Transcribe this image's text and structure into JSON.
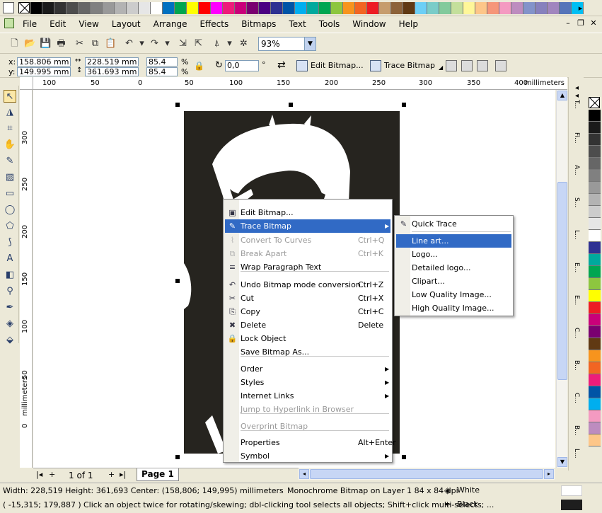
{
  "colors": {
    "chrome": "#ece9d8",
    "menu_highlight": "#316ac5",
    "bitmap_dark": "#26241f",
    "disabled_text": "#9a9a9a"
  },
  "palette_top": [
    "#000000",
    "#1a1a1a",
    "#333333",
    "#4d4d4d",
    "#666666",
    "#808080",
    "#999999",
    "#b3b3b3",
    "#cccccc",
    "#e6e6e6",
    "#ffffff",
    "#0070c0",
    "#00a550",
    "#ffff00",
    "#ff0000",
    "#ff00ff",
    "#ed1c7a",
    "#c9007a",
    "#7a0070",
    "#4b0082",
    "#2e3192",
    "#0054a6",
    "#00aeef",
    "#00a99d",
    "#00a651",
    "#8dc63f",
    "#f7941d",
    "#f26522",
    "#ed1c24",
    "#c69c6d",
    "#8c6239",
    "#603913",
    "#6dcff6",
    "#7accc8",
    "#82ca9c",
    "#c4df9b",
    "#fff799",
    "#fdc689",
    "#f69679",
    "#f49ac1",
    "#bd8cbf",
    "#8393ca",
    "#8781bd",
    "#a186be",
    "#5574b9",
    "#00bff3"
  ],
  "palette_right": [
    "#000000",
    "#1a1a1a",
    "#333333",
    "#4d4d4d",
    "#666666",
    "#808080",
    "#999999",
    "#b3b3b3",
    "#cccccc",
    "#e6e6e6",
    "#ffffff",
    "#2e3192",
    "#00a99d",
    "#00a651",
    "#8dc63f",
    "#ffff00",
    "#ed1c24",
    "#c9007a",
    "#7a0070",
    "#603913",
    "#f7941d",
    "#f26522",
    "#ed1c7a",
    "#0054a6",
    "#00aeef",
    "#f49ac1",
    "#bd8cbf",
    "#fdc689"
  ],
  "menubar": {
    "items": [
      "File",
      "Edit",
      "View",
      "Layout",
      "Arrange",
      "Effects",
      "Bitmaps",
      "Text",
      "Tools",
      "Window",
      "Help"
    ]
  },
  "standard_bar": {
    "zoom": "93%"
  },
  "property_bar": {
    "x_label": "x:",
    "y_label": "y:",
    "x": "158.806 mm",
    "y": "149.995 mm",
    "width": "228.519 mm",
    "height": "361.693 mm",
    "scale_w": "85.4",
    "scale_h": "85.4",
    "pct": "%",
    "angle": "0,0",
    "deg": "°",
    "edit_bitmap": "Edit Bitmap...",
    "trace_bitmap": "Trace Bitmap"
  },
  "hruler": {
    "ticks": [
      "100",
      "50",
      "0",
      "50",
      "100",
      "150",
      "200",
      "250",
      "300",
      "350",
      "400"
    ],
    "unit": "millimeters"
  },
  "vruler": {
    "ticks": [
      "300",
      "250",
      "200",
      "150",
      "100",
      "50",
      "0"
    ],
    "unit": "millimeters"
  },
  "dockers": [
    "T...",
    "Fi...",
    "A...",
    "S...",
    "L...",
    "E...",
    "E...",
    "C...",
    "B...",
    "C...",
    "B...",
    "L..."
  ],
  "context_menu": {
    "items": [
      {
        "label": "Edit Bitmap...",
        "shortcut": "",
        "icon": "edit-bitmap-icon",
        "state": "normal"
      },
      {
        "label": "Trace Bitmap",
        "shortcut": "",
        "icon": "trace-icon",
        "state": "highlight",
        "submenu": true
      },
      {
        "label": "Convert To Curves",
        "shortcut": "Ctrl+Q",
        "icon": "curves-icon",
        "state": "disabled"
      },
      {
        "label": "Break Apart",
        "shortcut": "Ctrl+K",
        "icon": "break-apart-icon",
        "state": "disabled"
      },
      {
        "label": "Wrap Paragraph Text",
        "shortcut": "",
        "icon": "wrap-text-icon",
        "state": "normal"
      },
      {
        "label": "Undo Bitmap mode conversion",
        "shortcut": "Ctrl+Z",
        "icon": "undo-icon",
        "state": "normal"
      },
      {
        "label": "Cut",
        "shortcut": "Ctrl+X",
        "icon": "scissors-icon",
        "state": "normal"
      },
      {
        "label": "Copy",
        "shortcut": "Ctrl+C",
        "icon": "copy-icon",
        "state": "normal"
      },
      {
        "label": "Delete",
        "shortcut": "Delete",
        "icon": "delete-icon",
        "state": "normal"
      },
      {
        "label": "Lock Object",
        "shortcut": "",
        "icon": "lock-icon",
        "state": "normal"
      },
      {
        "label": "Save Bitmap As...",
        "shortcut": "",
        "icon": "",
        "state": "normal"
      },
      {
        "label": "Order",
        "shortcut": "",
        "icon": "",
        "state": "normal",
        "submenu": true
      },
      {
        "label": "Styles",
        "shortcut": "",
        "icon": "",
        "state": "normal",
        "submenu": true
      },
      {
        "label": "Internet Links",
        "shortcut": "",
        "icon": "",
        "state": "normal",
        "submenu": true
      },
      {
        "label": "Jump to Hyperlink in Browser",
        "shortcut": "",
        "icon": "",
        "state": "disabled"
      },
      {
        "label": "Overprint Bitmap",
        "shortcut": "",
        "icon": "",
        "state": "disabled"
      },
      {
        "label": "Properties",
        "shortcut": "Alt+Enter",
        "icon": "",
        "state": "normal"
      },
      {
        "label": "Symbol",
        "shortcut": "",
        "icon": "",
        "state": "normal",
        "submenu": true
      }
    ]
  },
  "submenu": {
    "items": [
      {
        "label": "Quick Trace",
        "icon": "quick-trace-icon",
        "state": "normal"
      },
      {
        "label": "Line art...",
        "icon": "",
        "state": "highlight"
      },
      {
        "label": "Logo...",
        "icon": "",
        "state": "normal"
      },
      {
        "label": "Detailed logo...",
        "icon": "",
        "state": "normal"
      },
      {
        "label": "Clipart...",
        "icon": "",
        "state": "normal"
      },
      {
        "label": "Low Quality Image...",
        "icon": "",
        "state": "normal"
      },
      {
        "label": "High Quality Image...",
        "icon": "",
        "state": "normal"
      }
    ]
  },
  "pagenav": {
    "count": "1 of 1",
    "page": "Page 1"
  },
  "status": {
    "dims": "Width: 228,519  Height: 361,693  Center: (158,806; 149,995)  millimeters",
    "object": "Monochrome Bitmap on Layer 1 84 x 84 dpi",
    "fill": "White",
    "outline": "Black",
    "cursor": "( -15,315; 179,887 )",
    "hint": "Click an object twice for rotating/skewing; dbl-clicking tool selects all objects; Shift+click multi-selects; ..."
  }
}
